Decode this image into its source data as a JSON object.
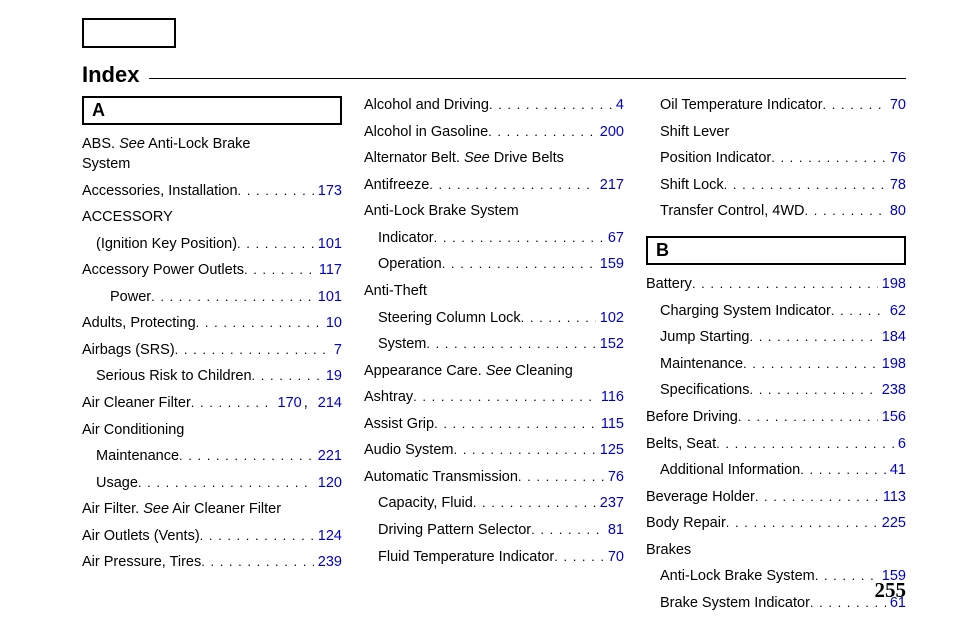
{
  "title": "Index",
  "pageNumber": "255",
  "col1": {
    "letter": "A",
    "items": [
      {
        "type": "note",
        "lines": [
          "ABS. <see>See</see> Anti-Lock Brake",
          " System"
        ]
      },
      {
        "type": "leader",
        "label": "Accessories, Installation",
        "pages": [
          "173"
        ]
      },
      {
        "type": "noteline",
        "text": "ACCESSORY"
      },
      {
        "type": "leader",
        "indent": 1,
        "label": "(Ignition Key Position)",
        "pages": [
          "101"
        ]
      },
      {
        "type": "leader",
        "label": "Accessory Power Outlets",
        "pages": [
          "117"
        ]
      },
      {
        "type": "leader",
        "indent": 2,
        "label": "Power",
        "pages": [
          "101"
        ]
      },
      {
        "type": "leader",
        "label": "Adults, Protecting",
        "pages": [
          "10"
        ]
      },
      {
        "type": "leader",
        "label": "Airbags (SRS)",
        "pages": [
          "7"
        ]
      },
      {
        "type": "leader",
        "indent": 1,
        "label": "Serious Risk to Children",
        "pages": [
          "19"
        ]
      },
      {
        "type": "leader",
        "label": "Air Cleaner Filter",
        "pages": [
          "170",
          "214"
        ]
      },
      {
        "type": "noteline",
        "text": "Air Conditioning"
      },
      {
        "type": "leader",
        "indent": 1,
        "label": "Maintenance",
        "pages": [
          "221"
        ]
      },
      {
        "type": "leader",
        "indent": 1,
        "label": "Usage",
        "pages": [
          "120"
        ]
      },
      {
        "type": "note",
        "lines": [
          "Air Filter. <see>See</see> Air Cleaner Filter"
        ]
      },
      {
        "type": "leader",
        "label": "Air Outlets (Vents)",
        "pages": [
          "124"
        ]
      },
      {
        "type": "leader",
        "label": "Air Pressure, Tires",
        "pages": [
          "239"
        ]
      }
    ]
  },
  "col2": {
    "items": [
      {
        "type": "leader",
        "label": "Alcohol and Driving",
        "pages": [
          "4"
        ]
      },
      {
        "type": "leader",
        "label": "Alcohol in Gasoline",
        "pages": [
          "200"
        ]
      },
      {
        "type": "note",
        "lines": [
          "Alternator Belt. <see>See</see> Drive Belts"
        ]
      },
      {
        "type": "leader",
        "label": "Antifreeze",
        "pages": [
          "217"
        ]
      },
      {
        "type": "noteline",
        "text": "Anti-Lock Brake System"
      },
      {
        "type": "leader",
        "indent": 1,
        "label": "Indicator",
        "pages": [
          "67"
        ]
      },
      {
        "type": "leader",
        "indent": 1,
        "label": "Operation",
        "pages": [
          "159"
        ]
      },
      {
        "type": "noteline",
        "text": "Anti-Theft"
      },
      {
        "type": "leader",
        "indent": 1,
        "label": "Steering Column Lock",
        "pages": [
          "102"
        ]
      },
      {
        "type": "leader",
        "indent": 1,
        "label": "System",
        "pages": [
          "152"
        ]
      },
      {
        "type": "note",
        "lines": [
          "Appearance Care. <see>See</see> Cleaning"
        ]
      },
      {
        "type": "leader",
        "label": "Ashtray",
        "pages": [
          "116"
        ]
      },
      {
        "type": "leader",
        "label": "Assist Grip",
        "pages": [
          "115"
        ]
      },
      {
        "type": "leader",
        "label": "Audio System",
        "pages": [
          "125"
        ]
      },
      {
        "type": "leader",
        "label": "Automatic Transmission",
        "pages": [
          "76"
        ]
      },
      {
        "type": "leader",
        "indent": 1,
        "label": "Capacity, Fluid",
        "pages": [
          "237"
        ]
      },
      {
        "type": "leader",
        "indent": 1,
        "label": "Driving Pattern Selector",
        "pages": [
          "81"
        ]
      },
      {
        "type": "leader",
        "indent": 1,
        "label": "Fluid Temperature Indicator",
        "pages": [
          "70"
        ]
      }
    ]
  },
  "col3": {
    "preItems": [
      {
        "type": "leader",
        "indent": 1,
        "label": "Oil Temperature Indicator",
        "pages": [
          "70"
        ]
      },
      {
        "type": "noteline",
        "indent": 1,
        "text": "Shift Lever"
      },
      {
        "type": "leader",
        "indent": 1,
        "label": " Position Indicator",
        "pages": [
          "76"
        ]
      },
      {
        "type": "leader",
        "indent": 1,
        "label": "Shift Lock",
        "pages": [
          "78"
        ]
      },
      {
        "type": "leader",
        "indent": 1,
        "label": "Transfer Control, 4WD",
        "pages": [
          "80"
        ]
      }
    ],
    "letter": "B",
    "items": [
      {
        "type": "leader",
        "label": "Battery",
        "pages": [
          "198"
        ]
      },
      {
        "type": "leader",
        "indent": 1,
        "label": "Charging System Indicator",
        "pages": [
          "62"
        ]
      },
      {
        "type": "leader",
        "indent": 1,
        "label": "Jump Starting",
        "pages": [
          "184"
        ]
      },
      {
        "type": "leader",
        "indent": 1,
        "label": "Maintenance",
        "pages": [
          "198"
        ]
      },
      {
        "type": "leader",
        "indent": 1,
        "label": "Specifications",
        "pages": [
          "238"
        ]
      },
      {
        "type": "leader",
        "label": "Before Driving",
        "pages": [
          "156"
        ]
      },
      {
        "type": "leader",
        "label": "Belts, Seat",
        "pages": [
          "6"
        ]
      },
      {
        "type": "leader",
        "indent": 1,
        "label": "Additional Information",
        "pages": [
          "41"
        ]
      },
      {
        "type": "leader",
        "label": "Beverage Holder",
        "pages": [
          "113"
        ]
      },
      {
        "type": "leader",
        "label": "Body Repair",
        "pages": [
          "225"
        ]
      },
      {
        "type": "noteline",
        "text": "Brakes"
      },
      {
        "type": "leader",
        "indent": 1,
        "label": "Anti-Lock Brake System",
        "pages": [
          "159"
        ]
      },
      {
        "type": "leader",
        "indent": 1,
        "label": "Brake System Indicator",
        "pages": [
          "61"
        ]
      }
    ]
  }
}
